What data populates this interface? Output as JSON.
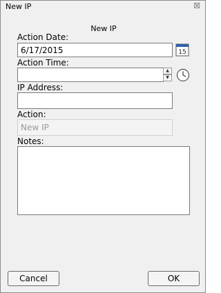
{
  "window": {
    "title": "New IP",
    "close_glyph": "☒"
  },
  "form": {
    "heading": "New IP",
    "action_date": {
      "label": "Action Date:",
      "value": "6/17/2015",
      "calendar_day": "15"
    },
    "action_time": {
      "label": "Action Time:",
      "value": ""
    },
    "ip_address": {
      "label": "IP Address:",
      "value": ""
    },
    "action": {
      "label": "Action:",
      "placeholder": "New IP"
    },
    "notes": {
      "label": "Notes:",
      "value": ""
    }
  },
  "buttons": {
    "cancel": "Cancel",
    "ok": "OK"
  },
  "icons": {
    "calendar": "calendar-icon",
    "clock": "clock-icon",
    "spin_up": "up-arrow",
    "spin_down": "down-arrow"
  },
  "colors": {
    "window_bg": "#f0f0f0",
    "field_border": "#7a7a7a",
    "disabled_text": "#9a9a9a",
    "calendar_blue": "#2f5fa8"
  }
}
